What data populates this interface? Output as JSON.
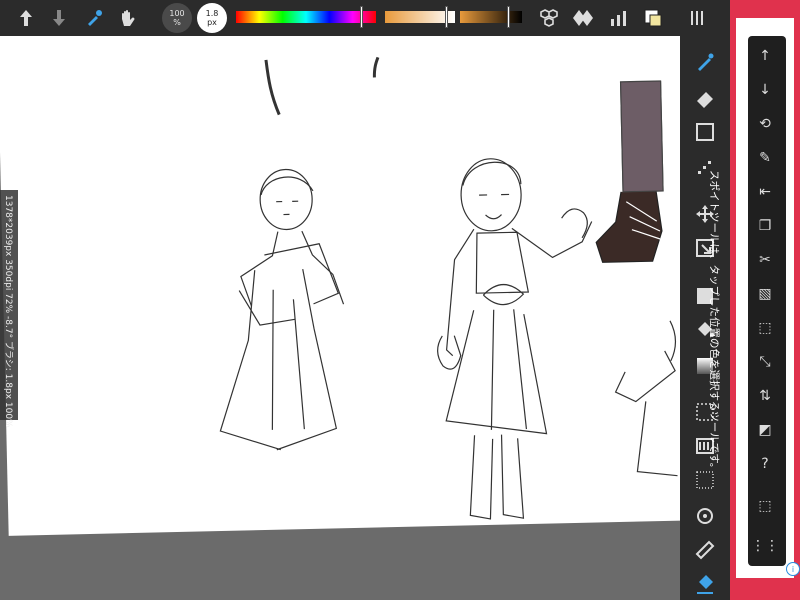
{
  "toolbar": {
    "undo_icon": "redo-up-arrow",
    "redo_icon": "down-arrow",
    "eyedropper_icon": "eyedropper",
    "hand_icon": "hand",
    "opacity_value": "100",
    "opacity_unit": "%",
    "brush_size_value": "1.8",
    "brush_size_unit": "px",
    "hue_color": "#ff0000",
    "current_color": "#e89a3c",
    "layers_icon": "layers",
    "materials_icon": "materials",
    "settings_icon": "chart",
    "color_swatch_icon": "color-swatch",
    "menu_icon": "hamburger"
  },
  "info_bar": {
    "text": "1378*2039px 350dpi 72% -8.7° ブラシ: 1.8px 100%"
  },
  "right_tools": [
    {
      "name": "brush-icon"
    },
    {
      "name": "eraser-icon"
    },
    {
      "name": "rectangle-icon"
    },
    {
      "name": "dot-icon"
    },
    {
      "name": "move-icon"
    },
    {
      "name": "transform-icon"
    },
    {
      "name": "fill-square-icon"
    },
    {
      "name": "bucket-icon"
    },
    {
      "name": "gradient-icon"
    },
    {
      "name": "select-icon"
    },
    {
      "name": "layer-list-icon"
    },
    {
      "name": "lasso-select-icon"
    },
    {
      "name": "rotate-icon"
    },
    {
      "name": "ruler-icon"
    },
    {
      "name": "fill-tool-icon"
    }
  ],
  "ad": {
    "message": "スポイトツールは、タップした位置の色を選択するツールです。",
    "background": "#e0324d",
    "info_symbol": "i"
  }
}
